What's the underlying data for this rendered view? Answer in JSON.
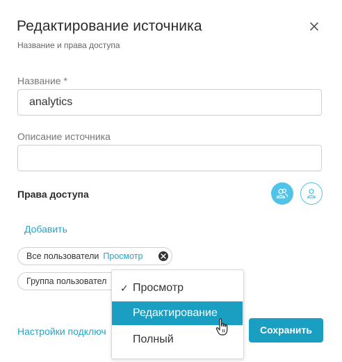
{
  "dialog": {
    "title": "Редактирование источника",
    "subtitle": "Название и права доступа",
    "close_icon": "close-icon"
  },
  "form": {
    "name_label": "Название *",
    "name_value": "analytics",
    "description_label": "Описание источника",
    "description_value": ""
  },
  "access": {
    "heading": "Права доступа",
    "group_toggle_icon": "users-icon",
    "user_toggle_icon": "user-icon",
    "add_label": "Добавить",
    "chips": [
      {
        "name": "Все пользователи",
        "permission": "Просмотр"
      },
      {
        "name": "Группа пользовател"
      }
    ]
  },
  "dropdown": {
    "options": [
      "Просмотр",
      "Редактирование",
      "Полный"
    ],
    "selected": "Просмотр",
    "highlighted": "Редактирование"
  },
  "footer": {
    "settings_link": "Настройки подключ",
    "save_label": "Сохранить"
  },
  "colors": {
    "accent": "#1a9fc3",
    "accent_light": "#4fc3e8",
    "link": "#1fa6c9"
  }
}
